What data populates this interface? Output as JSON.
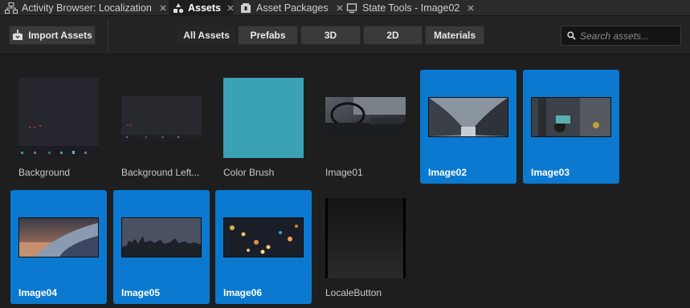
{
  "tabs": [
    {
      "label": "Activity Browser: Localization",
      "icon": "hierarchy-icon"
    },
    {
      "label": "Assets",
      "icon": "assets-icon"
    },
    {
      "label": "Asset Packages",
      "icon": "package-icon"
    },
    {
      "label": "State Tools - Image02",
      "icon": "monitor-icon"
    }
  ],
  "toolbar": {
    "import_label": "Import Assets",
    "filters": [
      "All Assets",
      "Prefabs",
      "3D",
      "2D",
      "Materials"
    ],
    "selected_filter": "All Assets"
  },
  "search": {
    "placeholder": "Search assets..."
  },
  "assets": [
    {
      "label": "Background",
      "selected": false,
      "thumb": "dark-ui-screen"
    },
    {
      "label": "Background Left...",
      "selected": false,
      "thumb": "dark-ui-strip"
    },
    {
      "label": "Color Brush",
      "selected": false,
      "thumb": "solid-color",
      "color": "#3aa2b4"
    },
    {
      "label": "Image01",
      "selected": false,
      "thumb": "car-interior"
    },
    {
      "label": "Image02",
      "selected": true,
      "thumb": "city-wing"
    },
    {
      "label": "Image03",
      "selected": true,
      "thumb": "scooter"
    },
    {
      "label": "Image04",
      "selected": true,
      "thumb": "airplane-wing"
    },
    {
      "label": "Image05",
      "selected": true,
      "thumb": "skyline"
    },
    {
      "label": "Image06",
      "selected": true,
      "thumb": "night-street"
    },
    {
      "label": "LocaleButton",
      "selected": false,
      "thumb": "black-button"
    }
  ],
  "colors": {
    "selection": "#0a79cf",
    "background": "#1e1e1e"
  }
}
